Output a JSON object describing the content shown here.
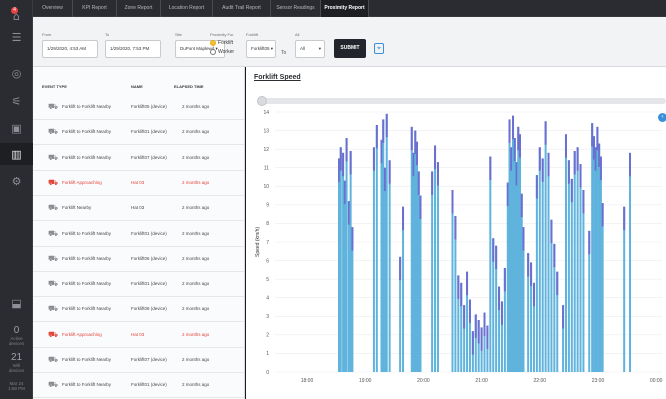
{
  "tabs": [
    "Overview",
    "KPI Report",
    "Zone Report",
    "Location Report",
    "Audit Trail Report",
    "Sensor Readings",
    "Proximity Report"
  ],
  "active_tab": "Proximity Report",
  "sidebar": {
    "icons": [
      "home-icon",
      "list-icon",
      "globe-icon",
      "sliders-icon",
      "image-icon",
      "chart-icon",
      "gear-icon",
      "download-icon"
    ],
    "badge": "4",
    "active_devices": {
      "value": "0",
      "label_line1": "Active",
      "label_line2": "devices"
    },
    "wifi_devices": {
      "value": "21",
      "label_line1": "Wifi",
      "label_line2": "devices"
    },
    "datetime": {
      "line1": "Mar 24",
      "line2": "1:58 PM"
    }
  },
  "filters": {
    "from_label": "From",
    "from_value": "1/29/2020, 4:53 AM",
    "to_label": "To",
    "to_value": "1/29/2020, 7:53 PM",
    "site_label": "Site",
    "site_value": "DuPont Maplewd ▾",
    "proximity_label": "Proximity For",
    "option_forklift": "Forklift",
    "option_worker": "Worker",
    "forklift_label": "Forklift",
    "forklift_value": "Forklift05 ▾",
    "to_separator": "To",
    "all_label": "All",
    "all_value": "All",
    "submit_label": "SUBMIT"
  },
  "events": {
    "headers": {
      "type": "EVENT TYPE",
      "name": "NAME",
      "elapsed": "ELAPSED TIME"
    },
    "rows": [
      {
        "type": "Forklift to Forklift Nearby",
        "name": "Forklift05 (device)",
        "elapsed": "2 months ago",
        "alert": false
      },
      {
        "type": "Forklift to Forklift Nearby",
        "name": "Forklift01 (device)",
        "elapsed": "2 months ago",
        "alert": false
      },
      {
        "type": "Forklift to Forklift Nearby",
        "name": "Forklift07 (device)",
        "elapsed": "2 months ago",
        "alert": false
      },
      {
        "type": "Forklift Approaching",
        "name": "Hat 03",
        "elapsed": "2 months ago",
        "alert": true
      },
      {
        "type": "Forklift Nearby",
        "name": "Hat 03",
        "elapsed": "2 months ago",
        "alert": false
      },
      {
        "type": "Forklift to Forklift Nearby",
        "name": "Forklift01 (device)",
        "elapsed": "2 months ago",
        "alert": false
      },
      {
        "type": "Forklift to Forklift Nearby",
        "name": "Forklift06 (device)",
        "elapsed": "2 months ago",
        "alert": false
      },
      {
        "type": "Forklift to Forklift Nearby",
        "name": "Forklift01 (device)",
        "elapsed": "2 months ago",
        "alert": false
      },
      {
        "type": "Forklift to Forklift Nearby",
        "name": "Forklift08 (device)",
        "elapsed": "2 months ago",
        "alert": false
      },
      {
        "type": "Forklift Approaching",
        "name": "Hat 03",
        "elapsed": "2 months ago",
        "alert": true
      },
      {
        "type": "Forklift to Forklift Nearby",
        "name": "Forklift07 (device)",
        "elapsed": "2 months ago",
        "alert": false
      },
      {
        "type": "Forklift to Forklift Nearby",
        "name": "Forklift01 (device)",
        "elapsed": "2 months ago",
        "alert": false
      }
    ]
  },
  "colors": {
    "bar_blue": "#5fb3dc",
    "bar_top": "#6a6fd0",
    "alert_red": "#e0443a",
    "accent_blue": "#3b8fd9"
  },
  "chart_data": {
    "type": "bar",
    "title": "Forklift Speed",
    "xlabel": "",
    "ylabel": "Speed (km/h)",
    "ylim": [
      0,
      14
    ],
    "yticks": [
      "0",
      "1",
      "2",
      "3",
      "4",
      "5",
      "6",
      "7",
      "8",
      "9",
      "10",
      "11",
      "12",
      "13",
      "14"
    ],
    "xticks": [
      "18:00",
      "19:00",
      "20:00",
      "21:00",
      "22:00",
      "23:00",
      "00:00"
    ],
    "x_hours": [
      18,
      19,
      20,
      21,
      22,
      23,
      24
    ],
    "grid": true,
    "series": [
      {
        "x": [
          18.55,
          18.58,
          18.62,
          18.65,
          18.68,
          18.72,
          18.75,
          18.78,
          19.15,
          19.2,
          19.28,
          19.31,
          19.34,
          19.37,
          19.42,
          19.6,
          19.65,
          19.8,
          19.83,
          19.86,
          19.89,
          19.92,
          19.95,
          20.15,
          20.2,
          20.25,
          20.5,
          20.55,
          20.6,
          20.65,
          20.7,
          20.75,
          20.8,
          20.85,
          20.9,
          20.95,
          21.0,
          21.05,
          21.1,
          21.15,
          21.2,
          21.25,
          21.3,
          21.35,
          21.4,
          21.45,
          21.48,
          21.51,
          21.54,
          21.57,
          21.6,
          21.63,
          21.66,
          21.69,
          21.72,
          21.8,
          21.85,
          21.9,
          21.95,
          22.0,
          22.05,
          22.1,
          22.15,
          22.2,
          22.25,
          22.3,
          22.4,
          22.45,
          22.5,
          22.55,
          22.6,
          22.65,
          22.7,
          22.75,
          22.85,
          22.9,
          22.93,
          22.96,
          22.99,
          23.02,
          23.05,
          23.08,
          23.45,
          23.55
        ],
        "values": [
          11.5,
          12.1,
          11.8,
          10.3,
          12.6,
          9.2,
          11.9,
          7.8,
          12.1,
          13.3,
          12.5,
          13.6,
          11.0,
          13.9,
          11.4,
          6.2,
          8.9,
          13.2,
          11.8,
          13.0,
          12.4,
          10.8,
          9.5,
          10.8,
          12.2,
          11.3,
          9.8,
          8.4,
          5.2,
          4.8,
          3.6,
          5.4,
          3.9,
          2.2,
          3.1,
          2.8,
          2.4,
          3.2,
          2.5,
          11.6,
          7.2,
          6.8,
          4.6,
          3.8,
          5.6,
          10.2,
          13.6,
          12.1,
          13.8,
          12.6,
          11.3,
          13.2,
          12.8,
          9.6,
          7.8,
          6.4,
          5.9,
          4.8,
          10.6,
          12.1,
          11.5,
          13.5,
          11.8,
          8.2,
          6.9,
          5.4,
          3.6,
          12.8,
          11.4,
          10.4,
          11.9,
          12.1,
          11.2,
          9.8,
          7.6,
          13.4,
          12.7,
          12.1,
          13.2,
          12.3,
          11.6,
          9.1,
          8.9,
          11.8
        ]
      }
    ]
  }
}
